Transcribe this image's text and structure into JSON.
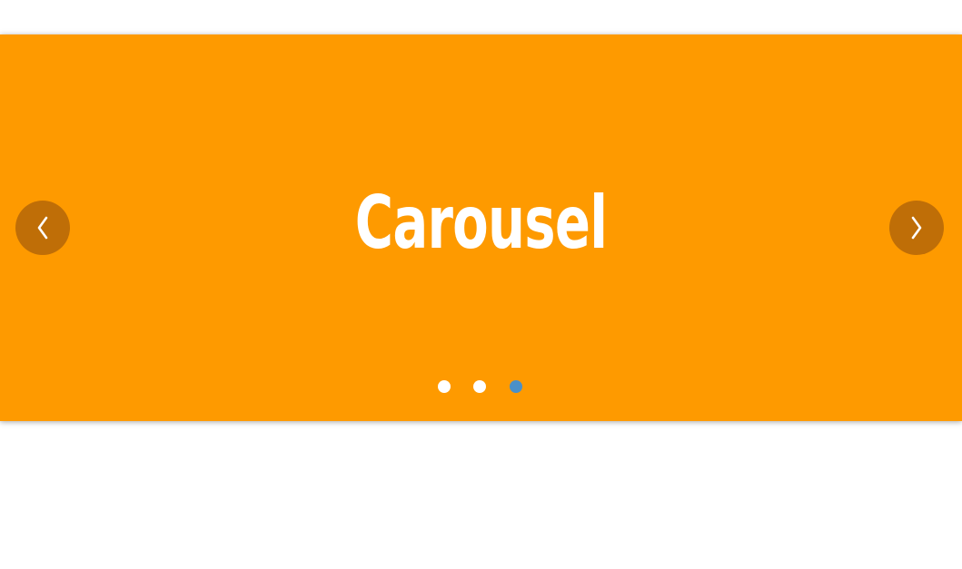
{
  "carousel": {
    "slide_title": "Carousel",
    "prev_icon": "chevron-left-icon",
    "next_icon": "chevron-right-icon",
    "active_slide_index": 3,
    "slide_count": 3,
    "colors": {
      "background": "#fe9a00",
      "arrow_background": "#bf6e07",
      "dot_inactive": "#ffffff",
      "dot_active": "#4a90c8",
      "title": "#ffffff"
    }
  }
}
